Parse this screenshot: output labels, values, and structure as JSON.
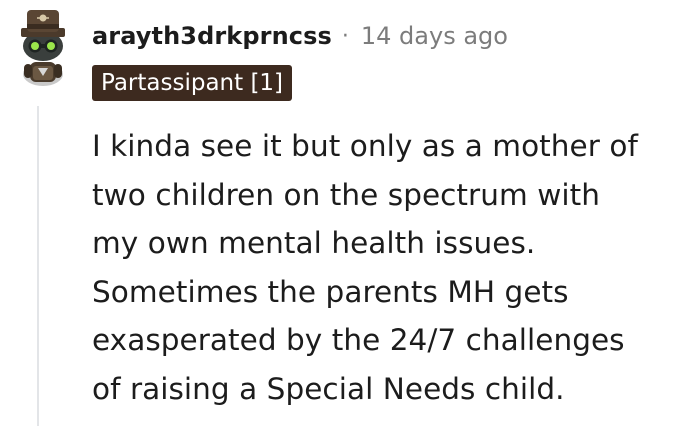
{
  "comment": {
    "username": "arayth3drkprncss",
    "separator": "·",
    "timestamp": "14 days ago",
    "flair": "Partassipant [1]",
    "avatar_icon": "snoo-avatar-icon",
    "body_lines": [
      "I kinda see it but only as a mother of",
      "two children on the spectrum with",
      "my own mental health issues.",
      "Sometimes the parents MH gets",
      "exasperated by the 24/7 challenges",
      "of raising a Special Needs child."
    ]
  },
  "colors": {
    "flair_background": "#3d2a1f",
    "muted_text": "#7c7c7c",
    "thread_line": "#e3e5e8"
  }
}
